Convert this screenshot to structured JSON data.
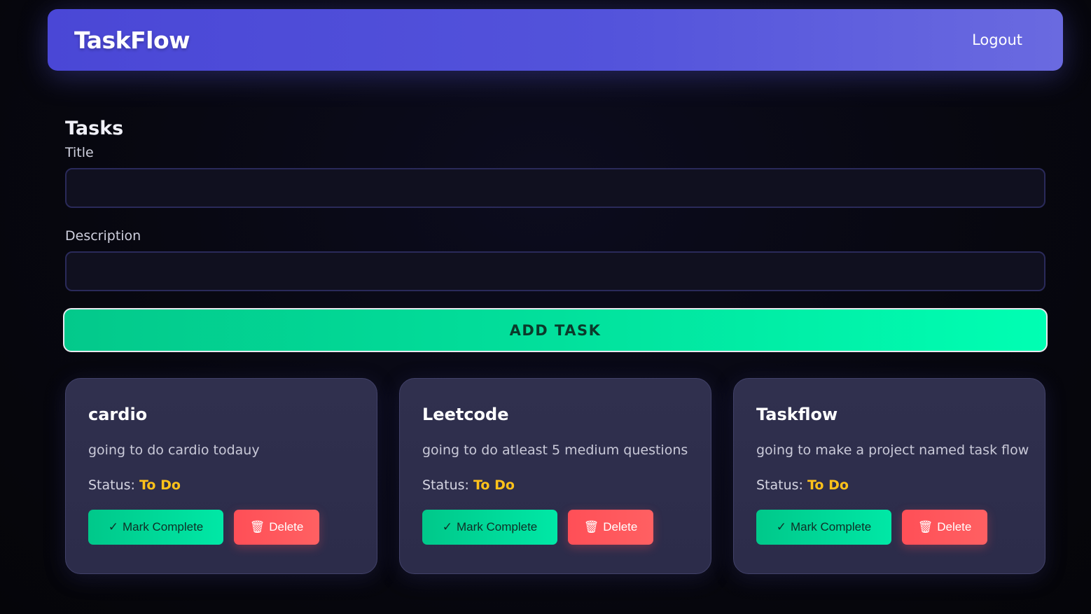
{
  "header": {
    "brand": "TaskFlow",
    "logout_label": "Logout"
  },
  "main": {
    "heading": "Tasks",
    "title_label": "Title",
    "description_label": "Description",
    "title_value": "",
    "description_value": "",
    "add_button_label": "ADD TASK"
  },
  "tasks": [
    {
      "title": "cardio",
      "description": "going to do cardio todauy",
      "status_label": "Status:",
      "status": "To Do"
    },
    {
      "title": "Leetcode",
      "description": "going to do atleast 5 medium questions",
      "status_label": "Status:",
      "status": "To Do"
    },
    {
      "title": "Taskflow",
      "description": "going to make a project named task flow",
      "status_label": "Status:",
      "status": "To Do"
    }
  ],
  "card_actions": {
    "complete_icon": "✓",
    "complete_label": "Mark Complete",
    "delete_icon": "🗑",
    "delete_label": "Delete"
  },
  "colors": {
    "navbar_accent": "#4a47d6",
    "add_button": "#00e8a6",
    "status_todo": "#ffc21a",
    "delete": "#ff4f57"
  }
}
